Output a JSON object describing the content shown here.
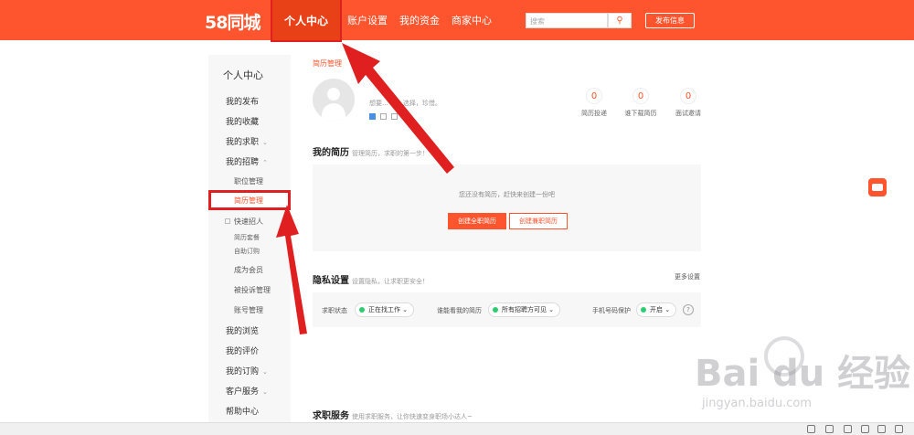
{
  "header": {
    "logo": "58同城",
    "nav": [
      "个人中心",
      "账户设置",
      "我的资金",
      "商家中心"
    ],
    "search_placeholder": "搜索",
    "search_button": "🔍",
    "post_button": "发布信息"
  },
  "sidebar": {
    "title": "个人中心",
    "items": [
      {
        "label": "我的发布"
      },
      {
        "label": "我的收藏"
      },
      {
        "label": "我的求职"
      },
      {
        "label": "我的招聘"
      },
      {
        "label": "职位管理"
      },
      {
        "label": "简历管理"
      },
      {
        "label": "快速招人"
      },
      {
        "label": "简历套餐"
      },
      {
        "label": "自助订购"
      },
      {
        "label": "成为会员"
      },
      {
        "label": "被投诉管理"
      },
      {
        "label": "账号管理"
      },
      {
        "label": "我的浏览"
      },
      {
        "label": "我的评价"
      },
      {
        "label": "我的订购"
      },
      {
        "label": "客户服务"
      },
      {
        "label": "帮助中心"
      }
    ]
  },
  "main": {
    "breadcrumb": "简历管理",
    "profile_tagline": "想要...        营，选择，珍惜。",
    "stats": [
      {
        "value": "0",
        "label": "简历投递"
      },
      {
        "value": "0",
        "label": "谁下载简历"
      },
      {
        "value": "0",
        "label": "面试邀请"
      }
    ],
    "resume": {
      "title": "我的简历",
      "subtitle": "管理简历，求职的第一步！",
      "empty": "您还没有简历，赶快来创建一份吧",
      "create_full": "创建全职简历",
      "create_part": "创建兼职简历"
    },
    "privacy": {
      "title": "隐私设置",
      "subtitle": "设置隐私，让求职更安全！",
      "more": "更多设置",
      "status_label": "求职状态",
      "status_value": "正在找工作",
      "viewer_label": "谁能看我的简历",
      "viewer_value": "所有招聘方可见",
      "phone_label": "手机号码保护",
      "phone_value": "开启",
      "help": "?"
    },
    "service": {
      "title": "求职服务",
      "subtitle": "使用求职服务，让你快速变身职场小达人~"
    }
  },
  "watermark": {
    "brand": "Bai  du 经验",
    "url": "jingyan.baidu.com"
  },
  "colors": {
    "brand": "#ff552e",
    "annotation": "#e02020"
  }
}
